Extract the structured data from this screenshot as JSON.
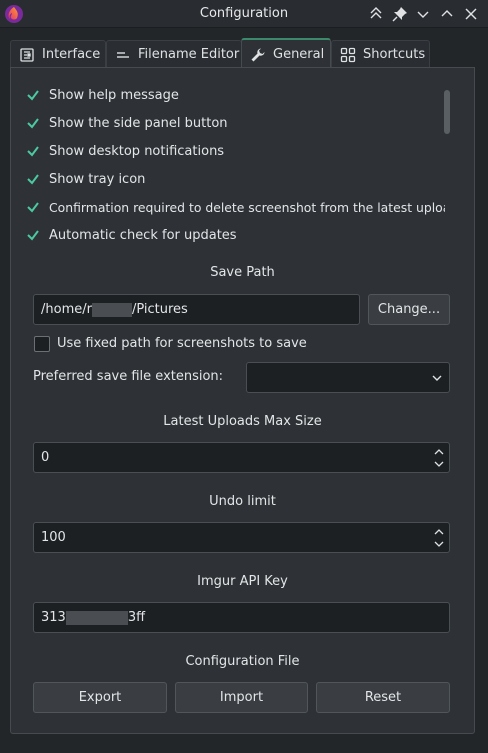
{
  "window": {
    "title": "Configuration"
  },
  "tabs": [
    {
      "label": "Interface",
      "icon": "interface-icon"
    },
    {
      "label": "Filename Editor",
      "icon": "filename-editor-icon"
    },
    {
      "label": "General",
      "icon": "wrench-icon",
      "active": true
    },
    {
      "label": "Shortcuts",
      "icon": "shortcuts-icon"
    }
  ],
  "general": {
    "options": [
      {
        "label": "Show help message",
        "checked": true
      },
      {
        "label": "Show the side panel button",
        "checked": true
      },
      {
        "label": "Show desktop notifications",
        "checked": true
      },
      {
        "label": "Show tray icon",
        "checked": true
      },
      {
        "label": "Confirmation required to delete screenshot from the latest uploads",
        "checked": true
      },
      {
        "label": "Automatic check for updates",
        "checked": true
      }
    ],
    "save_path": {
      "title": "Save Path",
      "value_prefix": "/home/r",
      "value_suffix": "/Pictures",
      "change_label": "Change...",
      "fixed_path_label": "Use fixed path for screenshots to save",
      "fixed_path_checked": false,
      "extension_label": "Preferred save file extension:",
      "extension_value": ""
    },
    "latest_uploads": {
      "title": "Latest Uploads Max Size",
      "value": "0"
    },
    "undo_limit": {
      "title": "Undo limit",
      "value": "100"
    },
    "imgur": {
      "title": "Imgur API Key",
      "value_prefix": "313",
      "value_suffix": "3ff"
    },
    "config_file": {
      "title": "Configuration File",
      "export_label": "Export",
      "import_label": "Import",
      "reset_label": "Reset"
    }
  },
  "colors": {
    "accent": "#3b8a6b",
    "check": "#4cc9a0",
    "background": "#232629"
  }
}
